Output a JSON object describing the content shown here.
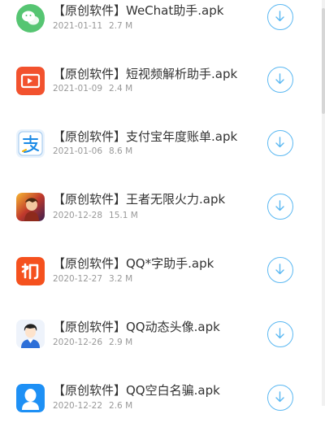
{
  "colors": {
    "accent": "#5bb8f2",
    "title": "#333333",
    "meta": "#999999"
  },
  "items": [
    {
      "name": "【原创软件】WeChat助手.apk",
      "date": "2021-01-11",
      "size": "2.7 M",
      "icon": "wechat-icon"
    },
    {
      "name": "【原创软件】短视频解析助手.apk",
      "date": "2021-01-09",
      "size": "2.4 M",
      "icon": "video-parser-icon"
    },
    {
      "name": "【原创软件】支付宝年度账单.apk",
      "date": "2021-01-06",
      "size": "8.6 M",
      "icon": "alipay-bill-icon"
    },
    {
      "name": "【原创软件】王者无限火力.apk",
      "date": "2020-12-28",
      "size": "15.1 M",
      "icon": "game-hero-icon"
    },
    {
      "name": "【原创软件】QQ*字助手.apk",
      "date": "2020-12-27",
      "size": "3.2 M",
      "icon": "qq-char-icon"
    },
    {
      "name": "【原创软件】QQ动态头像.apk",
      "date": "2020-12-26",
      "size": "2.9 M",
      "icon": "qq-avatar-icon"
    },
    {
      "name": "【原创软件】QQ空白名骗.apk",
      "date": "2020-12-22",
      "size": "2.6 M",
      "icon": "qq-blank-name-icon"
    }
  ],
  "download_icon": "download-icon"
}
